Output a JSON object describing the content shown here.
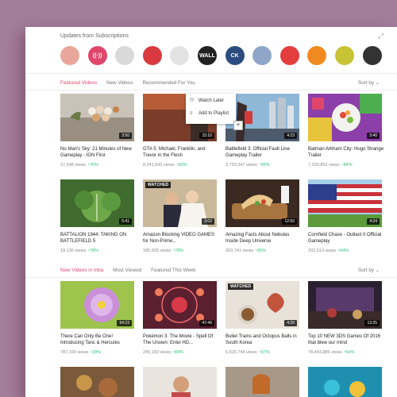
{
  "subscriptions": {
    "title": "Updates from Subscriptions",
    "avatars": [
      {
        "name": "avatar-1",
        "label": "",
        "color": "#e8a79a"
      },
      {
        "name": "avatar-2",
        "label": "((·))",
        "color": "#e0466b"
      },
      {
        "name": "avatar-3",
        "label": "",
        "color": "#d9d9d9"
      },
      {
        "name": "avatar-4",
        "label": "",
        "color": "#d9393f"
      },
      {
        "name": "avatar-5",
        "label": "",
        "color": "#e3e3e3"
      },
      {
        "name": "avatar-6",
        "label": "WALL",
        "color": "#222222"
      },
      {
        "name": "avatar-7",
        "label": "CK",
        "color": "#2b4c7e"
      },
      {
        "name": "avatar-8",
        "label": "",
        "color": "#8fa6c8"
      },
      {
        "name": "avatar-9",
        "label": "",
        "color": "#e43d3d"
      },
      {
        "name": "avatar-10",
        "label": "",
        "color": "#f08a1e"
      },
      {
        "name": "avatar-11",
        "label": "",
        "color": "#c8c335"
      },
      {
        "name": "avatar-12",
        "label": "",
        "color": "#333333"
      }
    ]
  },
  "section1": {
    "tabs": [
      "Featured Videos",
      "New Videos",
      "Recommended For You"
    ],
    "sort_label": "Sort by ⌄",
    "videos": [
      {
        "title": "No Man's Sky: 21 Minutes of New Gameplay - IGN First",
        "views": "27,548 views",
        "pct": "76%",
        "duration": "3:50",
        "watched": ""
      },
      {
        "title": "GTA 5: Michael, Franklin, and Trevor in the Flesh",
        "views": "8,241,542 views",
        "pct": "83%",
        "duration": "15:10",
        "watched": ""
      },
      {
        "title": "Battlefield 3: Official Fault Line Gameplay Trailer",
        "views": "2,729,347 views",
        "pct": "95%",
        "duration": "4:23",
        "watched": ""
      },
      {
        "title": "Batman Arkham City: Hugo Strange Trailer",
        "views": "7,239,852 views",
        "pct": "84%",
        "duration": "3:40",
        "watched": ""
      },
      {
        "title": "BATTALION 1944: TAKING ON BATTLEFIELD 5",
        "views": "19,130 views",
        "pct": "78%",
        "duration": "5:41",
        "watched": ""
      },
      {
        "title": "Amazon Blocking VIDEO GAMES for Non-Prime...",
        "views": "185,525 views",
        "pct": "78%",
        "duration": "3:02",
        "watched": "WATCHED"
      },
      {
        "title": "Amazing Facts About Nebulas Inside Deep Universe",
        "views": "203,741 views",
        "pct": "95%",
        "duration": "12:50",
        "watched": ""
      },
      {
        "title": "Cornfield Chase - Outlast II Official Gameplay",
        "views": "202,513 views",
        "pct": "64%",
        "duration": "4:24",
        "watched": ""
      }
    ],
    "menu": {
      "watch_later": "Watch Later",
      "add_playlist": "Add to Playlist"
    }
  },
  "section2": {
    "tabs": [
      "New Videos in Inba",
      "Most Viewed",
      "Featured This Week"
    ],
    "sort_label": "Sort by ⌄",
    "videos": [
      {
        "title": "There Can Only Be One! Introducing Tanc & Hercules",
        "views": "787,199 views",
        "pct": "28%",
        "duration": "54:23",
        "watched": ""
      },
      {
        "title": "Pokémon 3: The Movie - Spell Of The Unown: Entei HD...",
        "views": "245,183 views",
        "pct": "83%",
        "duration": "47:46",
        "watched": ""
      },
      {
        "title": "Bullet Trains and Octopus Balls in South Korea",
        "views": "6,815,744 views",
        "pct": "97%",
        "duration": "4:20",
        "watched": "WATCHED"
      },
      {
        "title": "Top 10 NEW 3DS Games Of 2016 that blew our mind",
        "views": "78,443,886 views",
        "pct": "64%",
        "duration": "13:25",
        "watched": ""
      }
    ]
  }
}
